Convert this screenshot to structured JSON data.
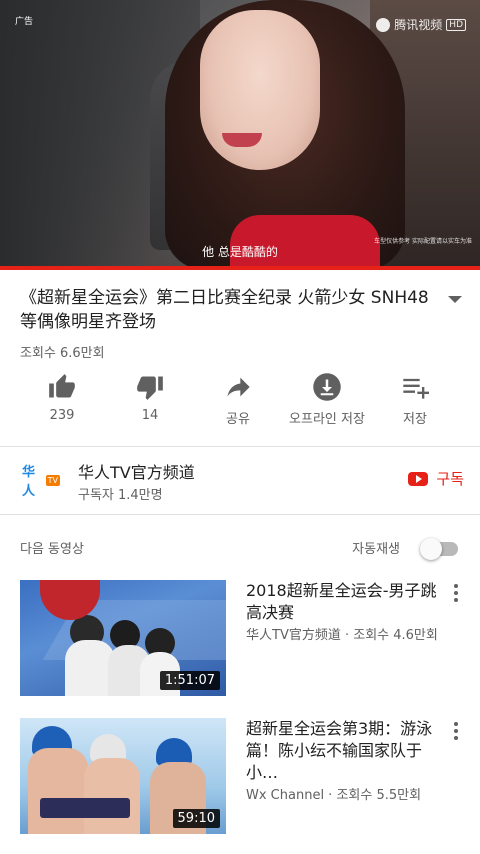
{
  "player": {
    "ad_label": "广告",
    "watermark": "腾讯视频",
    "watermark_badge": "HD",
    "subtitle": "他 总是酷酷的",
    "disclaimer": "车型仅供参考 实际配置请以实车为准",
    "progress": 1.0
  },
  "video": {
    "title": "《超新星全运会》第二日比赛全纪录 火箭少女 SNH48 等偶像明星齐登场",
    "views": "조회수 6.6만회"
  },
  "actions": {
    "like_count": "239",
    "dislike_count": "14",
    "share_label": "공유",
    "offline_label": "오프라인 저장",
    "save_label": "저장"
  },
  "channel": {
    "logo_text": "华人",
    "logo_badge": "TV",
    "name": "华人TV官方频道",
    "subscribers": "구독자 1.4만명",
    "subscribe_label": "구독"
  },
  "up_next": {
    "label": "다음 동영상",
    "autoplay_label": "자동재생",
    "autoplay_on": false
  },
  "videos": [
    {
      "title": "2018超新星全运会-男子跳高决赛",
      "meta": "华人TV官方频道 · 조회수 4.6만회",
      "duration": "1:51:07"
    },
    {
      "title": "超新星全运会第3期：游泳篇！陈小纭不输国家队于小…",
      "meta": "Wx Channel · 조회수 5.5만회",
      "duration": "59:10"
    }
  ],
  "colors": {
    "accent": "#e62117",
    "text": "#212121",
    "secondary": "#606060"
  }
}
